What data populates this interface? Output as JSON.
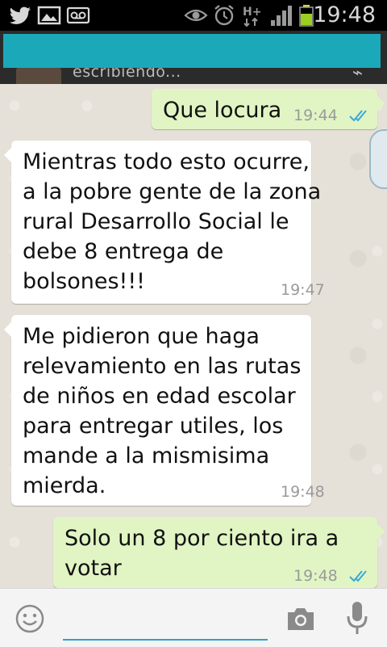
{
  "status_bar": {
    "time": "19:48",
    "icons": [
      "twitter-icon",
      "gallery-icon",
      "voicemail-icon",
      "eye-icon",
      "alarm-icon",
      "hplus-icon",
      "signal-icon",
      "battery-icon"
    ]
  },
  "header": {
    "contact_status": "escribiendo...",
    "overlay_color": "#1ba9b9"
  },
  "messages": [
    {
      "direction": "out",
      "text": "Que locura",
      "time": "19:44",
      "read": true
    },
    {
      "direction": "in",
      "text": "Mientras todo esto ocurre,\na la pobre gente de la zona\nrural Desarrollo Social le\ndebe 8 entrega de\nbolsones!!!",
      "time": "19:47"
    },
    {
      "direction": "in",
      "text": "Me pidieron que haga\nrelevamiento en las rutas\nde niños en edad escolar\npara entregar utiles, los\nmande a la mismisima\nmierda.",
      "time": "19:48"
    },
    {
      "direction": "out",
      "text": "Solo un 8 por ciento ira a\nvotar",
      "time": "19:48",
      "read": true
    }
  ],
  "input": {
    "placeholder": "",
    "icons": [
      "emoji-icon",
      "camera-icon",
      "mic-icon"
    ]
  },
  "colors": {
    "outgoing_bubble": "#e1f5c4",
    "incoming_bubble": "#ffffff",
    "read_ticks": "#3aa8d8",
    "chat_background": "#e6e1d8"
  }
}
